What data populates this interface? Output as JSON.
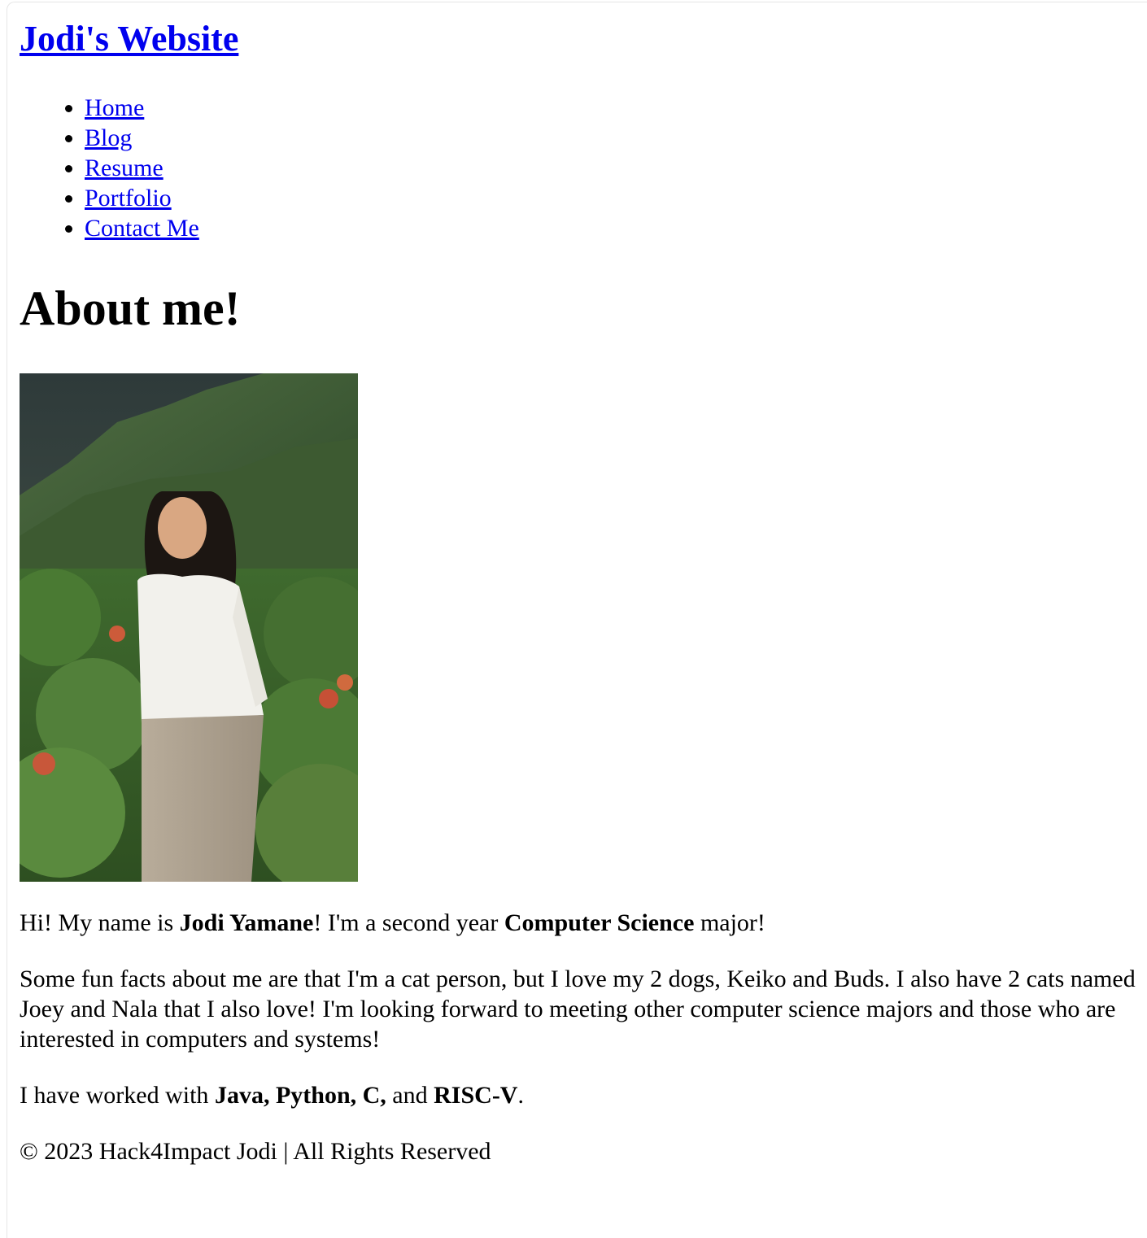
{
  "site": {
    "title": "Jodi's Website"
  },
  "nav": {
    "items": [
      "Home",
      "Blog",
      "Resume",
      "Portfolio",
      "Contact Me"
    ]
  },
  "about": {
    "heading": "About me!",
    "intro": {
      "t1": "Hi! My name is ",
      "name": "Jodi Yamane",
      "t2": "! I'm a second year ",
      "major": "Computer Science",
      "t3": " major!"
    },
    "fun_facts": "Some fun facts about me are that I'm a cat person, but I love my 2 dogs, Keiko and Buds. I also have 2 cats named Joey and Nala that I also love! I'm looking forward to meeting other computer science majors and those who are interested in computers and systems!",
    "skills": {
      "t1": "I have worked with ",
      "langs": "Java, Python, C,",
      "t2": " and ",
      "last": "RISC-V",
      "t3": "."
    }
  },
  "footer": {
    "text": "© 2023 Hack4Impact Jodi | All Rights Reserved"
  },
  "colors": {
    "link": "#0000ee",
    "text": "#000000",
    "background": "#ffffff"
  }
}
